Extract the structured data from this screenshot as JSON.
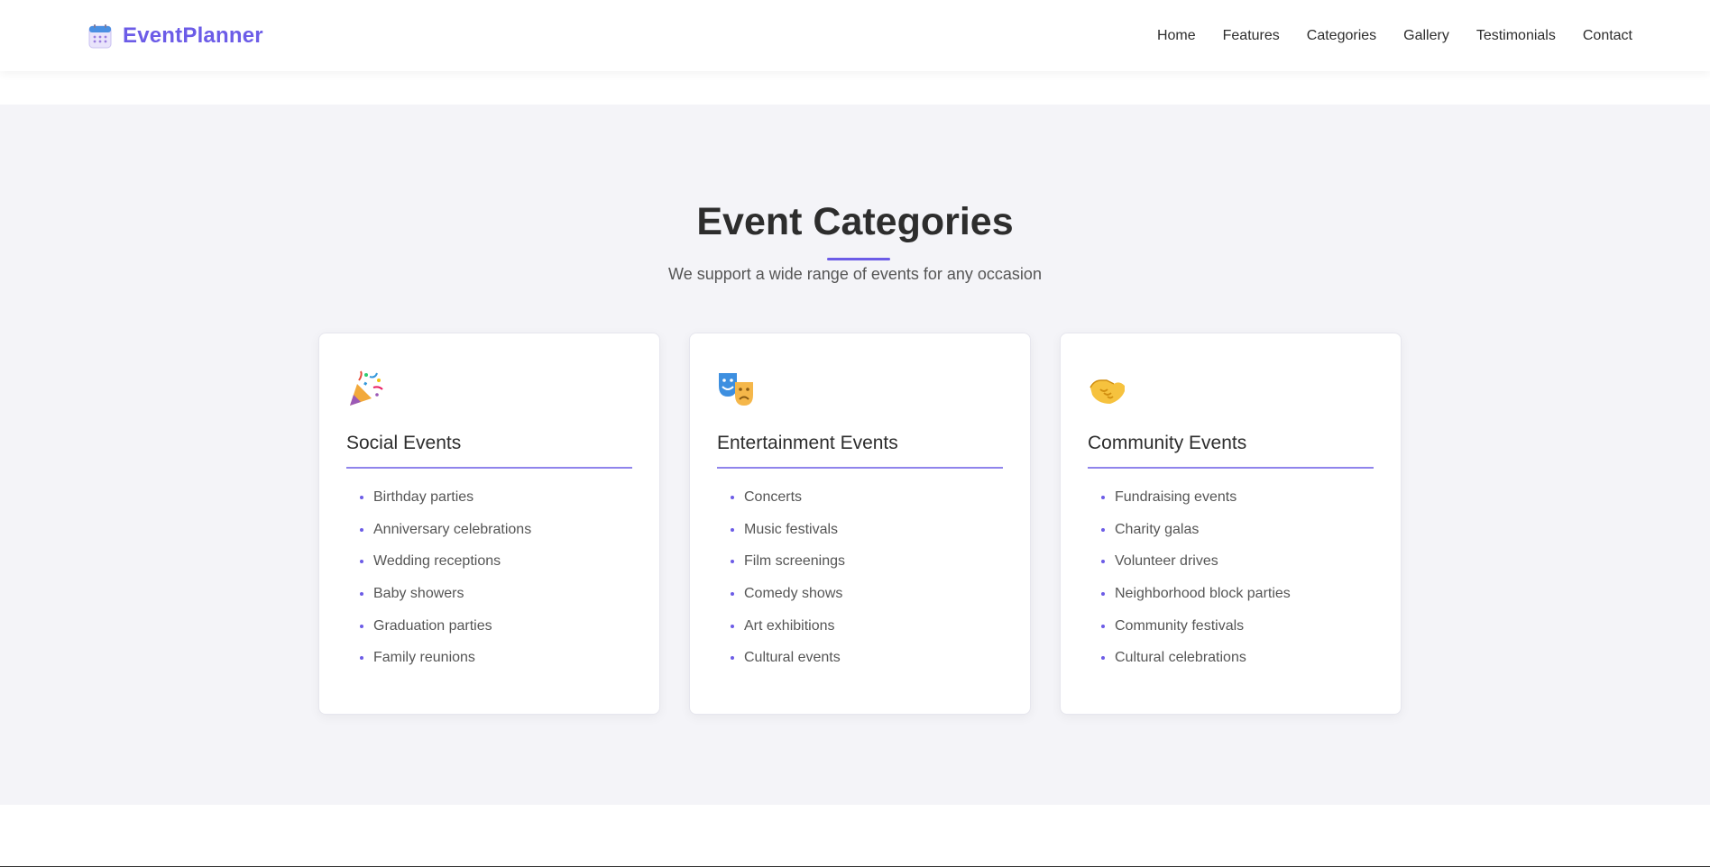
{
  "brand": {
    "name": "EventPlanner",
    "icon": "calendar-icon",
    "color": "#6c5ce7"
  },
  "nav": {
    "links": [
      {
        "label": "Home"
      },
      {
        "label": "Features"
      },
      {
        "label": "Categories"
      },
      {
        "label": "Gallery"
      },
      {
        "label": "Testimonials"
      },
      {
        "label": "Contact"
      }
    ]
  },
  "section": {
    "title": "Event Categories",
    "subtitle": "We support a wide range of events for any occasion",
    "accent_color": "#6c5ce7",
    "background": "#f4f4f8"
  },
  "cards": [
    {
      "icon": "party-popper-icon",
      "title": "Social Events",
      "items": [
        "Birthday parties",
        "Anniversary celebrations",
        "Wedding receptions",
        "Baby showers",
        "Graduation parties",
        "Family reunions"
      ]
    },
    {
      "icon": "theater-masks-icon",
      "title": "Entertainment Events",
      "items": [
        "Concerts",
        "Music festivals",
        "Film screenings",
        "Comedy shows",
        "Art exhibitions",
        "Cultural events"
      ]
    },
    {
      "icon": "handshake-icon",
      "title": "Community Events",
      "items": [
        "Fundraising events",
        "Charity galas",
        "Volunteer drives",
        "Neighborhood block parties",
        "Community festivals",
        "Cultural celebrations"
      ]
    }
  ]
}
